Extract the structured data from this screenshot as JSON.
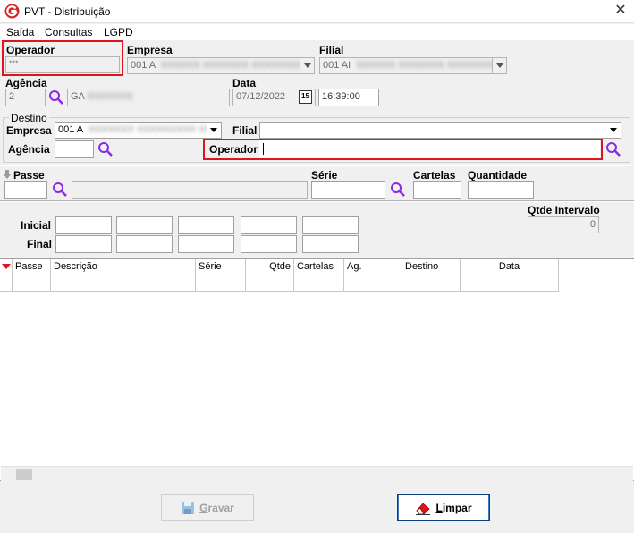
{
  "window": {
    "title": "PVT - Distribuição",
    "close_label": "✕"
  },
  "menu": {
    "items": [
      "Saída",
      "Consultas",
      "LGPD"
    ]
  },
  "origin": {
    "operador_label": "Operador",
    "operador_value": "***",
    "empresa_label": "Empresa",
    "empresa_value": "001 A",
    "filial_label": "Filial",
    "filial_value": "001 AI",
    "agencia_label": "Agência",
    "agencia_value": "2",
    "agencia_name": "GA",
    "data_label": "Data",
    "data_value": "07/12/2022",
    "calendar_label": "15",
    "hora_value": "16:39:00"
  },
  "destino": {
    "group_label": "Destino",
    "empresa_label": "Empresa",
    "empresa_value": "001 A",
    "filial_label": "Filial",
    "filial_value": "",
    "agencia_label": "Agência",
    "agencia_value": "",
    "operador_label": "Operador",
    "operador_value": ""
  },
  "passe": {
    "passe_label": "Passe",
    "serie_label": "Série",
    "cartelas_label": "Cartelas",
    "quantidade_label": "Quantidade"
  },
  "intervalo": {
    "inicial_label": "Inicial",
    "final_label": "Final",
    "qtde_label": "Qtde Intervalo",
    "qtde_value": "0"
  },
  "grid": {
    "columns": [
      "Passe",
      "Descrição",
      "Série",
      "Qtde",
      "Cartelas",
      "Ag.",
      "Destino",
      "Data"
    ]
  },
  "buttons": {
    "gravar_label": "Gravar",
    "limpar_label": "Limpar"
  },
  "colors": {
    "highlight": "#e0141e",
    "magnifier": "#8a2be2",
    "accent": "#0a3f7a"
  }
}
